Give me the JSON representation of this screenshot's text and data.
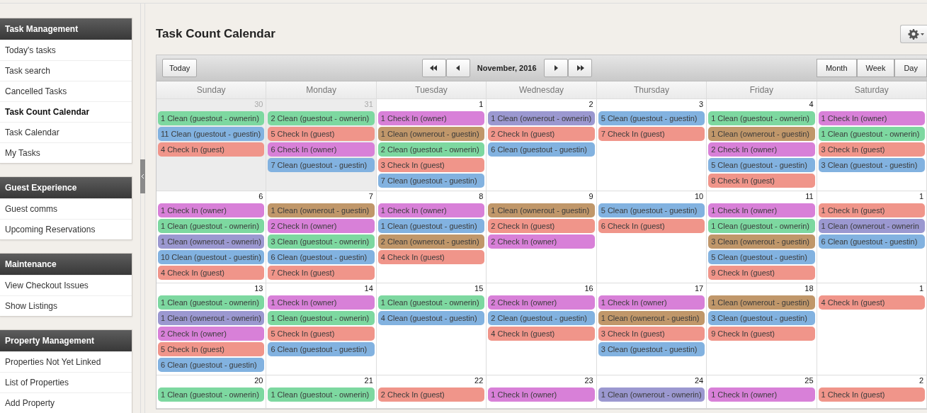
{
  "sidebar": {
    "groups": [
      {
        "title": "Task Management",
        "items": [
          {
            "label": "Today's tasks",
            "selected": false
          },
          {
            "label": "Task search",
            "selected": false
          },
          {
            "label": "Cancelled Tasks",
            "selected": false
          },
          {
            "label": "Task Count Calendar",
            "selected": true
          },
          {
            "label": "Task Calendar",
            "selected": false
          },
          {
            "label": "My Tasks",
            "selected": false
          }
        ]
      },
      {
        "title": "Guest Experience",
        "items": [
          {
            "label": "Guest comms",
            "selected": false
          },
          {
            "label": "Upcoming Reservations",
            "selected": false
          }
        ]
      },
      {
        "title": "Maintenance",
        "items": [
          {
            "label": "View Checkout Issues",
            "selected": false
          },
          {
            "label": "Show Listings",
            "selected": false
          }
        ]
      },
      {
        "title": "Property Management",
        "items": [
          {
            "label": "Properties Not Yet Linked",
            "selected": false
          },
          {
            "label": "List of Properties",
            "selected": false
          },
          {
            "label": "Add Property",
            "selected": false
          }
        ]
      }
    ]
  },
  "page": {
    "title": "Task Count Calendar"
  },
  "calendar": {
    "today_button": "Today",
    "month_label": "November, 2016",
    "views": [
      "Month",
      "Week",
      "Day"
    ],
    "weekdays": [
      "Sunday",
      "Monday",
      "Tuesday",
      "Wednesday",
      "Thursday",
      "Friday",
      "Saturday"
    ],
    "weeks": [
      {
        "days": [
          {
            "date": "30",
            "other_month": true,
            "events": [
              {
                "label": "1 Clean (guestout - ownerin)",
                "color": "#7dd8a0"
              },
              {
                "label": "11 Clean (guestout - guestin)",
                "color": "#82b2e0"
              },
              {
                "label": "4 Check In (guest)",
                "color": "#f0958a"
              }
            ]
          },
          {
            "date": "31",
            "other_month": true,
            "events": [
              {
                "label": "2 Clean (guestout - ownerin)",
                "color": "#7dd8a0"
              },
              {
                "label": "5 Check In (guest)",
                "color": "#f0958a"
              },
              {
                "label": "6 Check In (owner)",
                "color": "#d880d8"
              },
              {
                "label": "7 Clean (guestout - guestin)",
                "color": "#82b2e0"
              }
            ]
          },
          {
            "date": "1",
            "other_month": false,
            "events": [
              {
                "label": "1 Check In (owner)",
                "color": "#d880d8"
              },
              {
                "label": "1 Clean (ownerout - guestin)",
                "color": "#c0976a"
              },
              {
                "label": "2 Clean (guestout - ownerin)",
                "color": "#7dd8a0"
              },
              {
                "label": "3 Check In (guest)",
                "color": "#f0958a"
              },
              {
                "label": "7 Clean (guestout - guestin)",
                "color": "#82b2e0"
              }
            ]
          },
          {
            "date": "2",
            "other_month": false,
            "events": [
              {
                "label": "1 Clean (ownerout - ownerin)",
                "color": "#9b98d0"
              },
              {
                "label": "2 Check In (guest)",
                "color": "#f0958a"
              },
              {
                "label": "6 Clean (guestout - guestin)",
                "color": "#82b2e0"
              }
            ]
          },
          {
            "date": "3",
            "other_month": false,
            "events": [
              {
                "label": "5 Clean (guestout - guestin)",
                "color": "#82b2e0"
              },
              {
                "label": "7 Check In (guest)",
                "color": "#f0958a"
              }
            ]
          },
          {
            "date": "4",
            "other_month": false,
            "events": [
              {
                "label": "1 Clean (guestout - ownerin)",
                "color": "#7dd8a0"
              },
              {
                "label": "1 Clean (ownerout - guestin)",
                "color": "#c0976a"
              },
              {
                "label": "2 Check In (owner)",
                "color": "#d880d8"
              },
              {
                "label": "5 Clean (guestout - guestin)",
                "color": "#82b2e0"
              },
              {
                "label": "8 Check In (guest)",
                "color": "#f0958a"
              }
            ]
          },
          {
            "other_month": false,
            "events": [
              {
                "label": "1 Check In (owner)",
                "color": "#d880d8"
              },
              {
                "label": "1 Clean (guestout - ownerin)",
                "color": "#7dd8a0"
              },
              {
                "label": "3 Check In (guest)",
                "color": "#f0958a"
              },
              {
                "label": "3 Clean (guestout - guestin)",
                "color": "#82b2e0"
              }
            ]
          }
        ]
      },
      {
        "days": [
          {
            "date": "6",
            "other_month": false,
            "events": [
              {
                "label": "1 Check In (owner)",
                "color": "#d880d8"
              },
              {
                "label": "1 Clean (guestout - ownerin)",
                "color": "#7dd8a0"
              },
              {
                "label": "1 Clean (ownerout - ownerin)",
                "color": "#9b98d0"
              },
              {
                "label": "10 Clean (guestout - guestin)",
                "color": "#82b2e0"
              },
              {
                "label": "4 Check In (guest)",
                "color": "#f0958a"
              }
            ]
          },
          {
            "date": "7",
            "other_month": false,
            "events": [
              {
                "label": "1 Clean (ownerout - guestin)",
                "color": "#c0976a"
              },
              {
                "label": "2 Check In (owner)",
                "color": "#d880d8"
              },
              {
                "label": "3 Clean (guestout - ownerin)",
                "color": "#7dd8a0"
              },
              {
                "label": "6 Clean (guestout - guestin)",
                "color": "#82b2e0"
              },
              {
                "label": "7 Check In (guest)",
                "color": "#f0958a"
              }
            ]
          },
          {
            "date": "8",
            "other_month": false,
            "events": [
              {
                "label": "1 Check In (owner)",
                "color": "#d880d8"
              },
              {
                "label": "1 Clean (guestout - guestin)",
                "color": "#82b2e0"
              },
              {
                "label": "2 Clean (ownerout - guestin)",
                "color": "#c0976a"
              },
              {
                "label": "4 Check In (guest)",
                "color": "#f0958a"
              }
            ]
          },
          {
            "date": "9",
            "other_month": false,
            "events": [
              {
                "label": "1 Clean (ownerout - guestin)",
                "color": "#c0976a"
              },
              {
                "label": "2 Check In (guest)",
                "color": "#f0958a"
              },
              {
                "label": "2 Check In (owner)",
                "color": "#d880d8"
              }
            ]
          },
          {
            "date": "10",
            "other_month": false,
            "events": [
              {
                "label": "5 Clean (guestout - guestin)",
                "color": "#82b2e0"
              },
              {
                "label": "6 Check In (guest)",
                "color": "#f0958a"
              }
            ]
          },
          {
            "date": "11",
            "other_month": false,
            "events": [
              {
                "label": "1 Check In (owner)",
                "color": "#d880d8"
              },
              {
                "label": "1 Clean (guestout - ownerin)",
                "color": "#7dd8a0"
              },
              {
                "label": "3 Clean (ownerout - guestin)",
                "color": "#c0976a"
              },
              {
                "label": "5 Clean (guestout - guestin)",
                "color": "#82b2e0"
              },
              {
                "label": "9 Check In (guest)",
                "color": "#f0958a"
              }
            ]
          },
          {
            "date": "1",
            "other_month": false,
            "events": [
              {
                "label": "1 Check In (guest)",
                "color": "#f0958a"
              },
              {
                "label": "1 Clean (ownerout - ownerin",
                "color": "#9b98d0"
              },
              {
                "label": "6 Clean (guestout - guestin)",
                "color": "#82b2e0"
              }
            ]
          }
        ]
      },
      {
        "days": [
          {
            "date": "13",
            "other_month": false,
            "events": [
              {
                "label": "1 Clean (guestout - ownerin)",
                "color": "#7dd8a0"
              },
              {
                "label": "1 Clean (ownerout - ownerin)",
                "color": "#9b98d0"
              },
              {
                "label": "2 Check In (owner)",
                "color": "#d880d8"
              },
              {
                "label": "5 Check In (guest)",
                "color": "#f0958a"
              },
              {
                "label": "6 Clean (guestout - guestin)",
                "color": "#82b2e0"
              }
            ]
          },
          {
            "date": "14",
            "other_month": false,
            "events": [
              {
                "label": "1 Check In (owner)",
                "color": "#d880d8"
              },
              {
                "label": "1 Clean (guestout - ownerin)",
                "color": "#7dd8a0"
              },
              {
                "label": "5 Check In (guest)",
                "color": "#f0958a"
              },
              {
                "label": "6 Clean (guestout - guestin)",
                "color": "#82b2e0"
              }
            ]
          },
          {
            "date": "15",
            "other_month": false,
            "events": [
              {
                "label": "1 Clean (guestout - ownerin)",
                "color": "#7dd8a0"
              },
              {
                "label": "4 Clean (guestout - guestin)",
                "color": "#82b2e0"
              }
            ]
          },
          {
            "date": "16",
            "other_month": false,
            "events": [
              {
                "label": "2 Check In (owner)",
                "color": "#d880d8"
              },
              {
                "label": "2 Clean (guestout - guestin)",
                "color": "#82b2e0"
              },
              {
                "label": "4 Check In (guest)",
                "color": "#f0958a"
              }
            ]
          },
          {
            "date": "17",
            "other_month": false,
            "events": [
              {
                "label": "1 Check In (owner)",
                "color": "#d880d8"
              },
              {
                "label": "1 Clean (ownerout - guestin)",
                "color": "#c0976a"
              },
              {
                "label": "3 Check In (guest)",
                "color": "#f0958a"
              },
              {
                "label": "3 Clean (guestout - guestin)",
                "color": "#82b2e0"
              }
            ]
          },
          {
            "date": "18",
            "other_month": false,
            "events": [
              {
                "label": "1 Clean (ownerout - guestin)",
                "color": "#c0976a"
              },
              {
                "label": "3 Clean (guestout - guestin)",
                "color": "#82b2e0"
              },
              {
                "label": "9 Check In (guest)",
                "color": "#f0958a"
              }
            ]
          },
          {
            "date": "1",
            "other_month": false,
            "events": [
              {
                "label": "4 Check In (guest)",
                "color": "#f0958a"
              }
            ]
          }
        ]
      },
      {
        "days": [
          {
            "date": "20",
            "other_month": false,
            "events": [
              {
                "label": "1 Clean (guestout - ownerin)",
                "color": "#7dd8a0"
              }
            ]
          },
          {
            "date": "21",
            "other_month": false,
            "events": [
              {
                "label": "1 Clean (guestout - ownerin)",
                "color": "#7dd8a0"
              }
            ]
          },
          {
            "date": "22",
            "other_month": false,
            "events": [
              {
                "label": "2 Check In (guest)",
                "color": "#f0958a"
              }
            ]
          },
          {
            "date": "23",
            "other_month": false,
            "events": [
              {
                "label": "1 Check In (owner)",
                "color": "#d880d8"
              }
            ]
          },
          {
            "date": "24",
            "other_month": false,
            "events": [
              {
                "label": "1 Clean (ownerout - ownerin)",
                "color": "#9b98d0"
              }
            ]
          },
          {
            "date": "25",
            "other_month": false,
            "events": [
              {
                "label": "1 Check In (owner)",
                "color": "#d880d8"
              }
            ]
          },
          {
            "date": "2",
            "other_month": false,
            "events": [
              {
                "label": "1 Check In (guest)",
                "color": "#f0958a"
              }
            ]
          }
        ]
      }
    ]
  }
}
